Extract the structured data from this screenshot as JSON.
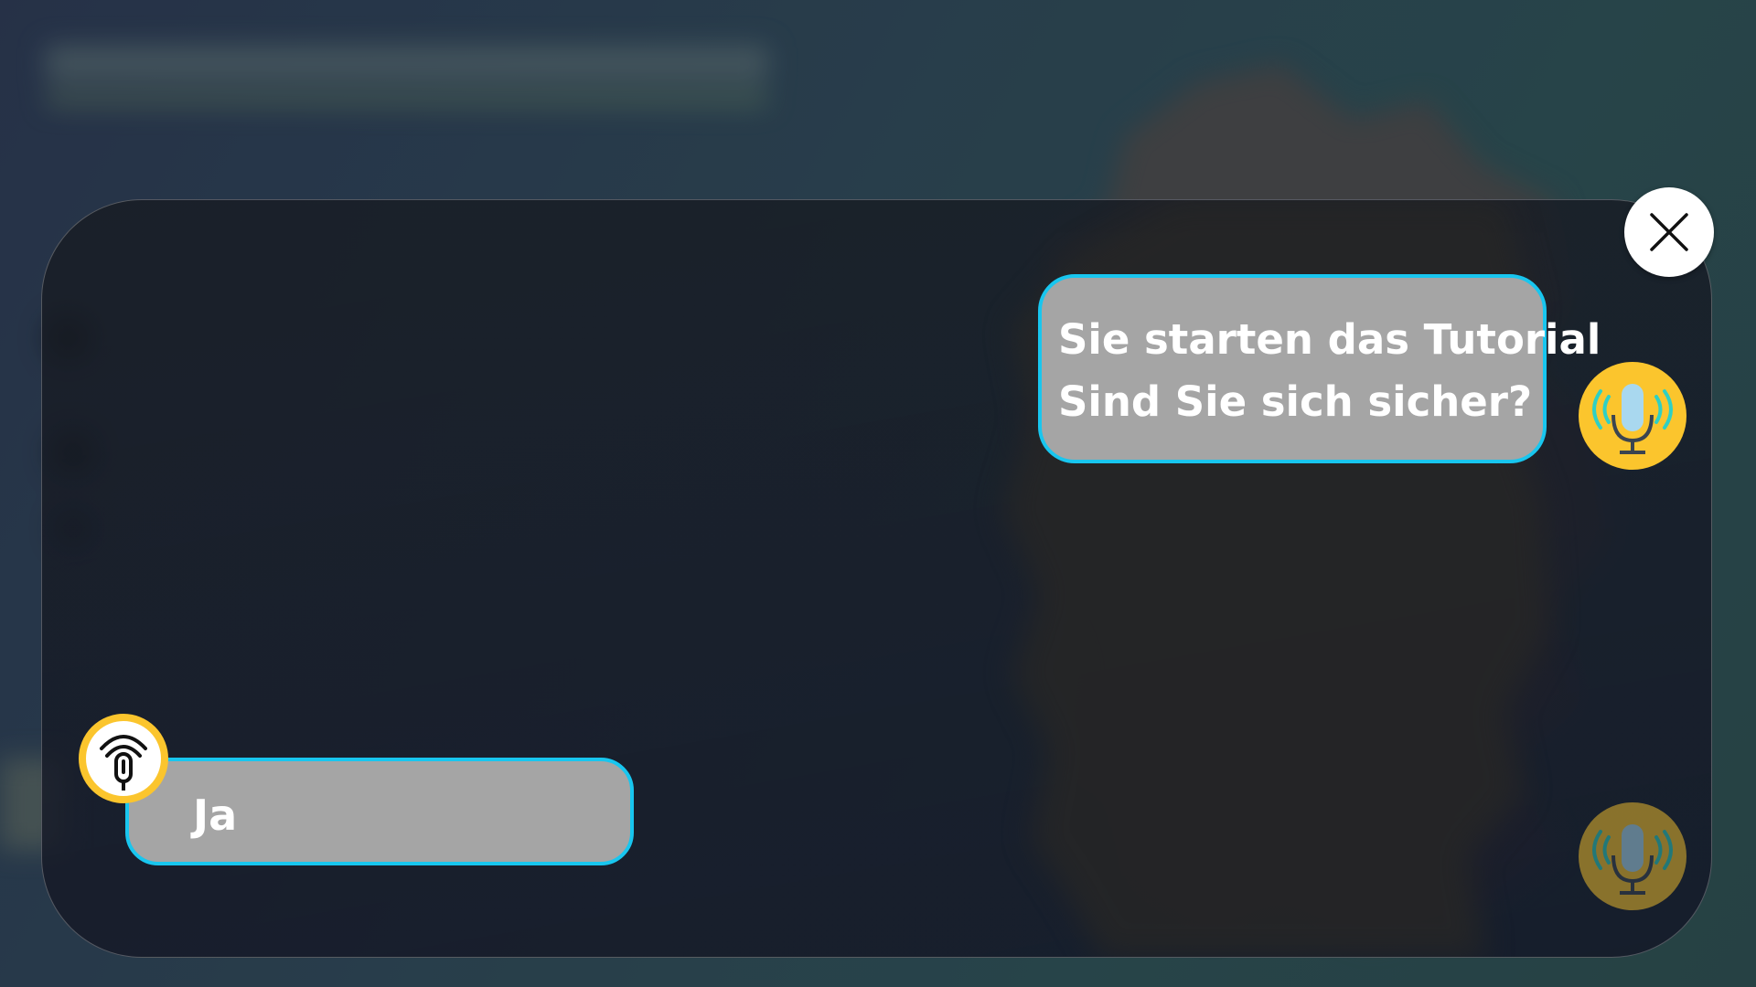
{
  "dialog": {
    "bot_message": {
      "line1": "Sie starten das Tutorial",
      "line2": "Sind Sie sich sicher?"
    },
    "user_message": "Ja",
    "close_icon": "close-icon",
    "bot_mic_icon": "microphone-speaking-icon",
    "user_mic_icon": "microphone-listening-icon",
    "idle_mic_icon": "microphone-speaking-icon"
  },
  "colors": {
    "bubble_fill": "#a5a5a5",
    "bubble_border": "#18c6ef",
    "mic_badge": "#fbc52d",
    "close_button": "#ffffff"
  }
}
